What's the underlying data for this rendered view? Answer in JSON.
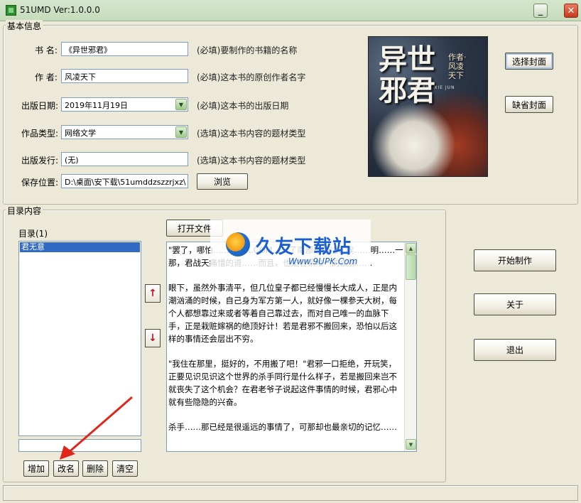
{
  "window": {
    "title": "51UMD Ver:1.0.0.0",
    "minimize_glyph": "_",
    "close_glyph": "✕"
  },
  "basic_info": {
    "legend": "基本信息",
    "book_name": {
      "label": "书  名:",
      "value": "《异世邪君》",
      "note": "(必填)要制作的书籍的名称"
    },
    "author": {
      "label": "作  者:",
      "value": "风凌天下",
      "note": "(必填)这本书的原创作者名字"
    },
    "publish_date": {
      "label": "出版日期:",
      "value": "2019年11月19日",
      "note": "(必填)这本书的出版日期"
    },
    "genre": {
      "label": "作品类型:",
      "value": "网络文学",
      "note": "(选填)这本书内容的题材类型"
    },
    "publisher": {
      "label": "出版发行:",
      "value": "(无)",
      "note": "(选填)这本书内容的题材类型"
    },
    "save_location": {
      "label": "保存位置:",
      "value": "D:\\桌面\\安下载\\51umddzszzrjxz\\",
      "browse_label": "浏览"
    },
    "cover": {
      "title": "异世邪君",
      "author_line": "作者·风凌天下",
      "pinyin": "YI SHI XIE JUN"
    },
    "select_cover_label": "选择封面",
    "default_cover_label": "缺省封面"
  },
  "toc": {
    "legend": "目录内容",
    "list_label": "目录(1)",
    "items": [
      "君无意"
    ],
    "rename_value": "",
    "open_file_label": "打开文件",
    "add_label": "增加",
    "rename_label": "改名",
    "delete_label": "删除",
    "clear_label": "清空",
    "move_up_glyph": "↑",
    "move_down_glyph": "↓"
  },
  "content": {
    "paragraphs": [
      "\"罢了，哪怕……9UPK.COM……了南部最南边，唉……明……一那，君战天痛惜的道……而且，也是君家唯一的血脉……",
      "    眼下，虽然外事清平，但几位皇子都已经慢慢长大成人，正是内潮汹涌的时候，自己身为军方第一人，就好像一棵参天大树，每个人都想靠过来或者等着自己靠过去，而对自己唯一的血脉下手，正是栽赃嫁祸的绝顶好计！若是君邪不搬回来，恐怕以后这样的事情还会层出不穷。",
      "    \"我住在那里，挺好的，不用搬了吧！\"君邪一口拒绝，开玩笑，正要见识见识这个世界的杀手同行是什么样子，若是搬回来岂不就丧失了这个机会？在君老爷子说起这件事情的时候，君邪心中就有些隐隐的兴奋。",
      "    杀手……那已经是很遥远的事情了，可那却也最亲切的记忆……"
    ]
  },
  "actions": {
    "start_label": "开始制作",
    "about_label": "关于",
    "exit_label": "退出"
  },
  "watermark": {
    "title": "久友下载站",
    "url": "Www.9UPK.Com"
  },
  "status": {
    "text": ""
  },
  "colors": {
    "selection": "#316ac5",
    "annotation_arrow": "#e0251b",
    "watermark_blue": "#1c5fcf"
  }
}
